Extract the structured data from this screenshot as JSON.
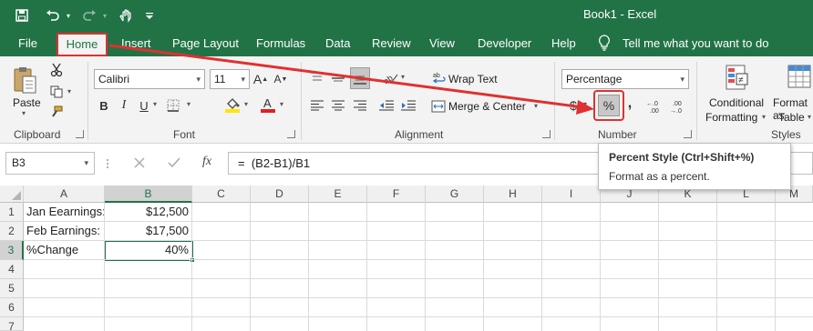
{
  "window": {
    "title": "Book1  -  Excel"
  },
  "ribbon_tabs": [
    "File",
    "Home",
    "Insert",
    "Page Layout",
    "Formulas",
    "Data",
    "Review",
    "View",
    "Developer",
    "Help"
  ],
  "tell_me": "Tell me what you want to do",
  "clipboard": {
    "paste": "Paste",
    "label": "Clipboard"
  },
  "font": {
    "name": "Calibri",
    "size": "11",
    "bold": "B",
    "italic": "I",
    "underline": "U",
    "label": "Font"
  },
  "alignment": {
    "wrap_text": "Wrap Text",
    "merge_center": "Merge & Center",
    "label": "Alignment"
  },
  "number": {
    "format": "Percentage",
    "currency": "$",
    "percent": "%",
    "comma": ",",
    "inc_dec": "←.0 .00",
    "dec_dec": ".00 →.0",
    "label": "Number"
  },
  "styles": {
    "conditional_1": "Conditional",
    "conditional_2": "Formatting",
    "format_as_1": "Format as",
    "format_as_2": "Table",
    "label": "Styles"
  },
  "formula_bar": {
    "name_box": "B3",
    "fx": "fx",
    "formula": "=  (B2-B1)/B1"
  },
  "tooltip": {
    "title": "Percent Style (Ctrl+Shift+%)",
    "description": "Format as a percent."
  },
  "columns": [
    "A",
    "B",
    "C",
    "D",
    "E",
    "F",
    "G",
    "H",
    "I",
    "J",
    "K",
    "L",
    "M"
  ],
  "rows": [
    "1",
    "2",
    "3",
    "4",
    "5",
    "6",
    "7"
  ],
  "cells": {
    "A1": "Jan Eearnings:",
    "B1": "$12,500",
    "A2": "Feb Earnings:",
    "B2": "$17,500",
    "A3": "%Change",
    "B3": "40%"
  },
  "colors": {
    "excel_green": "#217346",
    "annotation_red": "#e03030"
  }
}
